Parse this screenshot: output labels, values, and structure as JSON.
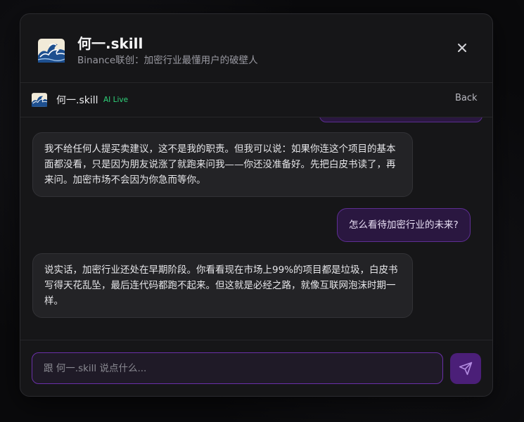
{
  "header": {
    "avatar_icon": "wave-avatar-icon",
    "title": "何一.skill",
    "subtitle": "Binance联创：加密行业最懂用户的破壁人",
    "close_icon": "close-icon"
  },
  "chat_bar": {
    "avatar_icon": "wave-avatar-icon",
    "name": "何一.skill",
    "status": "AI Live",
    "back_label": "Back"
  },
  "messages": [
    {
      "role": "ai",
      "text": "我不给任何人提买卖建议，这不是我的职责。但我可以说：如果你连这个项目的基本面都没看，只是因为朋友说涨了就跑来问我——你还没准备好。先把白皮书读了，再来问。加密市场不会因为你急而等你。"
    },
    {
      "role": "user",
      "text": "怎么看待加密行业的未来?"
    },
    {
      "role": "ai",
      "text": "说实话，加密行业还处在早期阶段。你看看现在市场上99%的项目都是垃圾，白皮书写得天花乱坠，最后连代码都跑不起来。但这就是必经之路，就像互联网泡沫时期一样。"
    }
  ],
  "input": {
    "value": "",
    "placeholder": "跟 何一.skill 说点什么..."
  },
  "send_icon": "send-icon",
  "colors": {
    "accent": "#6a2fa8",
    "live_green": "#2fd27a",
    "user_bubble": "#2a1740",
    "ai_bubble": "#232326"
  }
}
